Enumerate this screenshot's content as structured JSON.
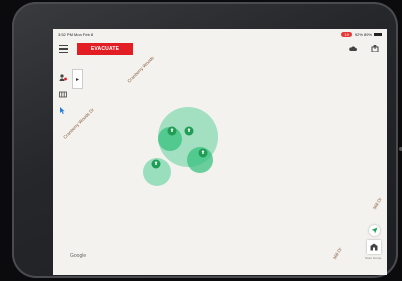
{
  "status_bar": {
    "left": "3:52 PM  Mon Feb 8",
    "rec": "19",
    "right": "92% 89%"
  },
  "toolbar": {
    "evacuate_label": "EVACUATE"
  },
  "map": {
    "streets": [
      "Cranberry Woods",
      "Cranberry Woods Dr",
      "Mill Dr",
      "Mill Dr"
    ],
    "attribution": "Google",
    "store_caption": "Store Group"
  },
  "colors": {
    "evacuate": "#e21d24",
    "zone_fill": "#5fd29b",
    "marker": "#1f9d55"
  },
  "icons": [
    "menu-icon",
    "cloud-icon",
    "share-icon",
    "people-icon",
    "grid-icon",
    "cursor-icon",
    "locate-icon",
    "store-icon"
  ]
}
